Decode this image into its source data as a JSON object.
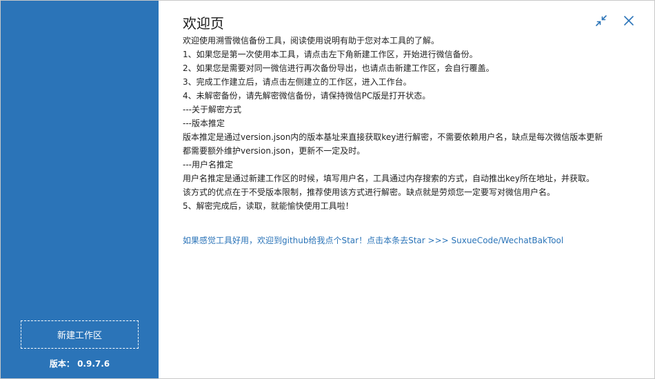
{
  "sidebar": {
    "new_workspace_label": "新建工作区",
    "version_label": "版本：",
    "version_value": "0.9.7.6"
  },
  "main": {
    "title": "欢迎页",
    "lines": [
      "欢迎使用溯雪微信备份工具，阅读使用说明有助于您对本工具的了解。",
      "1、如果您是第一次使用本工具，请点击左下角新建工作区，开始进行微信备份。",
      "2、如果您是需要对同一微信进行再次备份导出，也请点击新建工作区，会自行覆盖。",
      "3、完成工作建立后，请点击左侧建立的工作区，进入工作台。",
      "4、未解密备份，请先解密微信备份，请保持微信PC版是打开状态。",
      "---关于解密方式",
      "---版本推定",
      "版本推定是通过version.json内的版本基址来直接获取key进行解密，不需要依赖用户名，缺点是每次微信版本更新",
      "都需要额外维护version.json，更新不一定及时。",
      "---用户名推定",
      "用户名推定是通过新建工作区的时候，填写用户名，工具通过内存搜索的方式，自动推出key所在地址，并获取。",
      "该方式的优点在于不受版本限制，推荐使用该方式进行解密。缺点就是劳烦您一定要写对微信用户名。",
      "5、解密完成后，读取，就能愉快使用工具啦！"
    ],
    "star_link": "如果感觉工具好用，欢迎到github给我点个Star！点击本条去Star  >>>  SuxueCode/WechatBakTool"
  },
  "colors": {
    "sidebar_bg": "#2b74b8",
    "link": "#2b74b8",
    "icon": "#2b74b8"
  },
  "icons": {
    "minimize": "shrink-arrows-icon",
    "close": "close-icon"
  }
}
